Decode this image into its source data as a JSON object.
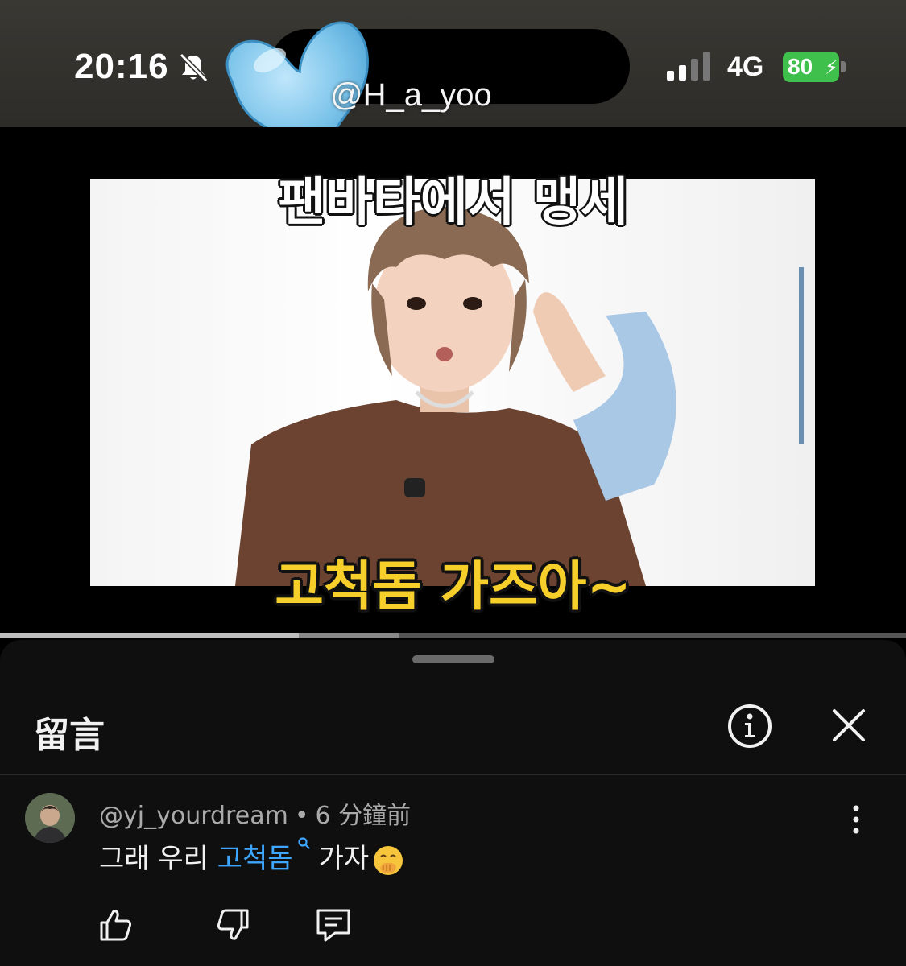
{
  "status_bar": {
    "time": "20:16",
    "network": "4G",
    "battery": "80",
    "battery_level_percent": 80,
    "icons": [
      "bell-muted-icon",
      "signal-icon",
      "charging-bolt-icon"
    ]
  },
  "watermark": {
    "text": "@H_a_yoo",
    "icon": "blue-heart-icon",
    "color": "#7cc4ea"
  },
  "video": {
    "caption_top": "팬바타에서 맹세",
    "caption_bottom": "고척돔 가즈아~",
    "caption_bottom_color": "#f7cf2b",
    "progress_fraction": 0.33,
    "buffered_fraction": 0.44
  },
  "comments_panel": {
    "title": "留言",
    "icons": [
      "info-icon",
      "close-icon"
    ],
    "comment": {
      "author": "@yj_yourdream",
      "separator": "•",
      "time": "6 分鐘前",
      "text_before": "그래 우리 ",
      "link_text": "고척돔",
      "text_after": "가자",
      "emoji": "face-with-hand-over-mouth",
      "link_color": "#3ea6ff",
      "actions": [
        "like-icon",
        "dislike-icon",
        "reply-icon"
      ]
    }
  }
}
